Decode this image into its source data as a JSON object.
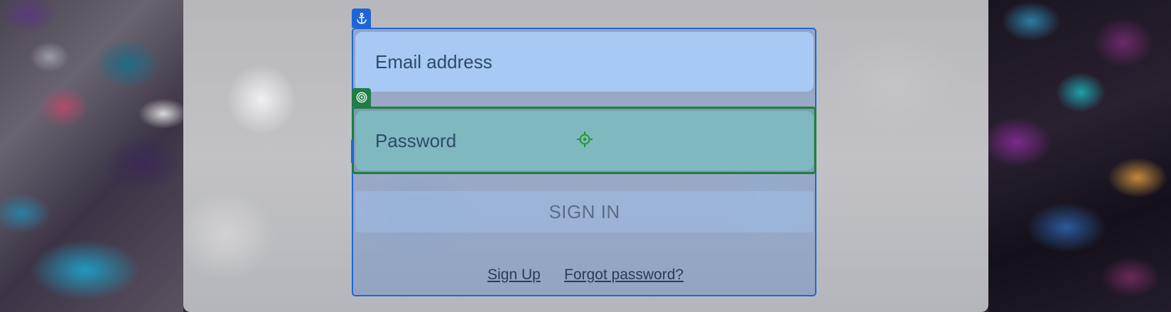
{
  "login_form": {
    "email_placeholder": "Email address",
    "password_placeholder": "Password",
    "signin_label": "SIGN IN",
    "signup_label": "Sign Up",
    "forgot_label": "Forgot password?"
  },
  "overlay": {
    "anchor_icon": "anchor-icon",
    "target_icon": "concentric-target-icon",
    "cursor_icon": "crosshair-icon",
    "anchor_color": "#1e66d8",
    "highlight_color": "#1f7d45"
  }
}
